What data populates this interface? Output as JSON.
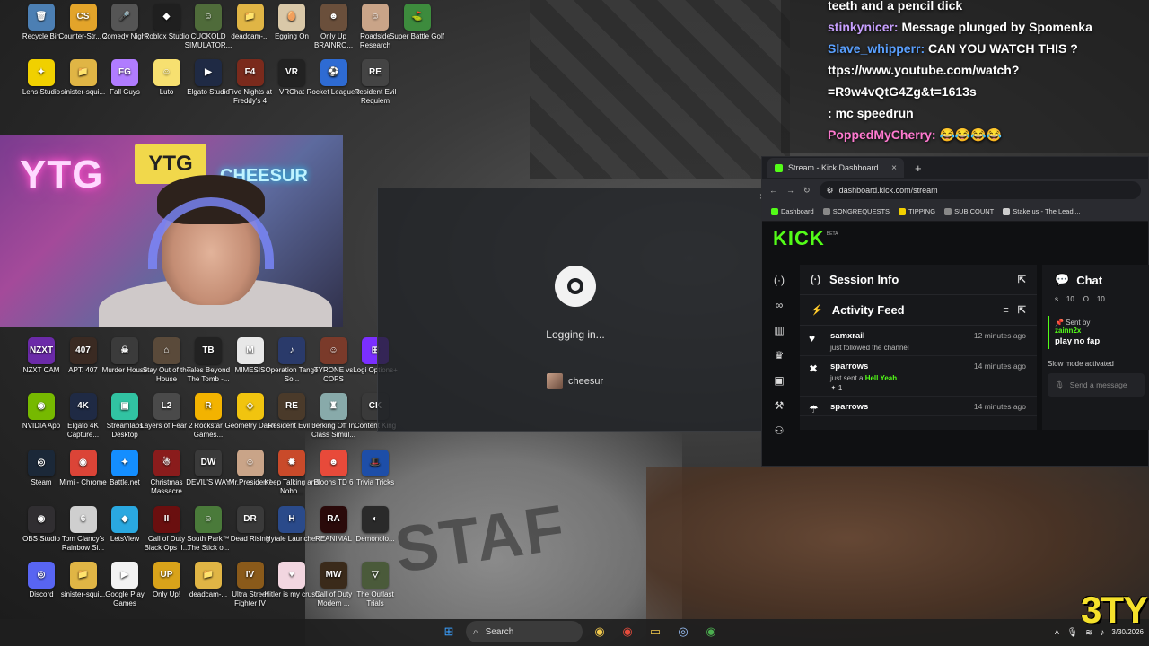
{
  "desktop_icons": [
    {
      "label": "Recycle Bin",
      "color": "#4c7fb3",
      "glyph": "🗑"
    },
    {
      "label": "Counter-Str... 2",
      "color": "#e3a42a",
      "glyph": "CS"
    },
    {
      "label": "Comedy Night",
      "color": "#555555",
      "glyph": "🎤"
    },
    {
      "label": "Roblox Studio",
      "color": "#1f1f1f",
      "glyph": "◆"
    },
    {
      "label": "CUCKOLD SIMULATOR...",
      "color": "#4f6b3a",
      "glyph": "☺"
    },
    {
      "label": "deadcam-...",
      "color": "#e0b545",
      "glyph": "📁"
    },
    {
      "label": "Egging On",
      "color": "#d9c8a8",
      "glyph": "🥚"
    },
    {
      "label": "Only Up BRAINRO...",
      "color": "#6a4f3b",
      "glyph": "☻"
    },
    {
      "label": "Roadside Research",
      "color": "#c9a488",
      "glyph": "☺"
    },
    {
      "label": "Super Battle Golf",
      "color": "#3d8b3d",
      "glyph": "⛳"
    },
    {
      "label": "Lens Studio",
      "color": "#f0d000",
      "glyph": "✦"
    },
    {
      "label": "sinister-squi...",
      "color": "#e0b545",
      "glyph": "📁"
    },
    {
      "label": "Fall Guys",
      "color": "#b07cff",
      "glyph": "FG"
    },
    {
      "label": "Luto",
      "color": "#f7e070",
      "glyph": "☺"
    },
    {
      "label": "Elgato Studio",
      "color": "#1f2a44",
      "glyph": "▶"
    },
    {
      "label": "Five Nights at Freddy's 4",
      "color": "#7a2a1c",
      "glyph": "F4"
    },
    {
      "label": "VRChat",
      "color": "#222222",
      "glyph": "VR"
    },
    {
      "label": "Rocket League®",
      "color": "#2e6bd3",
      "glyph": "⚽"
    },
    {
      "label": "Resident Evil Requiem",
      "color": "#444444",
      "glyph": "RE"
    },
    {
      "label": "NZXT CAM",
      "color": "#6b2aa8",
      "glyph": "NZXT"
    },
    {
      "label": "APT. 407",
      "color": "#3a2a22",
      "glyph": "407"
    },
    {
      "label": "Murder House",
      "color": "#3b3b3b",
      "glyph": "☠"
    },
    {
      "label": "Stay Out of the House",
      "color": "#5a4a3a",
      "glyph": "⌂"
    },
    {
      "label": "Tales Beyond The Tomb -...",
      "color": "#222222",
      "glyph": "TB"
    },
    {
      "label": "MIMESIS",
      "color": "#e8e8e8",
      "glyph": "M"
    },
    {
      "label": "Operation Tango So...",
      "color": "#2a3a6a",
      "glyph": "♪"
    },
    {
      "label": "TYRONE vs COPS",
      "color": "#7a3a2a",
      "glyph": "☺"
    },
    {
      "label": "Logi Options+",
      "color": "#7b2fff",
      "glyph": "⊞"
    },
    {
      "label": "NVIDIA App",
      "color": "#76b900",
      "glyph": "◉"
    },
    {
      "label": "Elgato 4K Capture...",
      "color": "#1f2a44",
      "glyph": "4K"
    },
    {
      "label": "Streamlabs Desktop",
      "color": "#31c3a2",
      "glyph": "▣"
    },
    {
      "label": "Layers of Fear 2",
      "color": "#4a4a4a",
      "glyph": "L2"
    },
    {
      "label": "Rockstar Games...",
      "color": "#f3b300",
      "glyph": "R"
    },
    {
      "label": "Geometry Dash",
      "color": "#f1c40f",
      "glyph": "◇"
    },
    {
      "label": "Resident Evil 5",
      "color": "#4a3a2a",
      "glyph": "RE"
    },
    {
      "label": "Jerking Off In Class Simul...",
      "color": "#8aa",
      "glyph": "♜"
    },
    {
      "label": "Content King",
      "color": "#3a3a3a",
      "glyph": "CK"
    },
    {
      "label": "Steam",
      "color": "#1b2838",
      "glyph": "◎"
    },
    {
      "label": "Mimi - Chrome",
      "color": "#db4437",
      "glyph": "◉"
    },
    {
      "label": "Battle.net",
      "color": "#148eff",
      "glyph": "✦"
    },
    {
      "label": "Christmas Massacre",
      "color": "#8a1c1c",
      "glyph": "☃"
    },
    {
      "label": "DEVIL'S WAY",
      "color": "#3a3a3a",
      "glyph": "DW"
    },
    {
      "label": "Mr.President!",
      "color": "#c9a488",
      "glyph": "☺"
    },
    {
      "label": "Keep Talking and Nobo...",
      "color": "#c94a2a",
      "glyph": "✹"
    },
    {
      "label": "Bloons TD 6",
      "color": "#e84a3a",
      "glyph": "☻"
    },
    {
      "label": "Trivia Tricks",
      "color": "#1d4ea8",
      "glyph": "🎩"
    },
    {
      "label": "OBS Studio",
      "color": "#302e31",
      "glyph": "◉"
    },
    {
      "label": "Tom Clancy's Rainbow Si...",
      "color": "#cfcfcf",
      "glyph": "6"
    },
    {
      "label": "LetsView",
      "color": "#2aa8e0",
      "glyph": "◆"
    },
    {
      "label": "Call of Duty Black Ops II...",
      "color": "#6a0f0f",
      "glyph": "II"
    },
    {
      "label": "South Park™ The Stick o...",
      "color": "#4a7a3a",
      "glyph": "☺"
    },
    {
      "label": "Dead Rising",
      "color": "#3a3a3a",
      "glyph": "DR"
    },
    {
      "label": "Hytale Launcher",
      "color": "#2a4a8a",
      "glyph": "H"
    },
    {
      "label": "REANIMAL",
      "color": "#2a0a0a",
      "glyph": "RA"
    },
    {
      "label": "Demonolo...",
      "color": "#2a2a2a",
      "glyph": "◐"
    },
    {
      "label": "Discord",
      "color": "#5865f2",
      "glyph": "◎"
    },
    {
      "label": "sinister-squi...",
      "color": "#e0b545",
      "glyph": "📁"
    },
    {
      "label": "Google Play Games",
      "color": "#f2f2f2",
      "glyph": "▶"
    },
    {
      "label": "Only Up!",
      "color": "#d9a31a",
      "glyph": "UP"
    },
    {
      "label": "deadcam-...",
      "color": "#e0b545",
      "glyph": "📁"
    },
    {
      "label": "Ultra Street Fighter IV",
      "color": "#8a5a1a",
      "glyph": "IV"
    },
    {
      "label": "Hitler is my crush",
      "color": "#f2d6e0",
      "glyph": "♥"
    },
    {
      "label": "Call of Duty Modern ...",
      "color": "#3a2a1a",
      "glyph": "MW"
    },
    {
      "label": "The Outlast Trials",
      "color": "#4a5a3a",
      "glyph": "▽"
    }
  ],
  "webcam": {
    "sign1": "YTG",
    "sign2": "YTG",
    "sign3": "CHEESUR"
  },
  "chat_overlay": [
    {
      "name": "",
      "text": "teeth and a pencil dick",
      "name_color": "#ffffff"
    },
    {
      "name": "stinkynicer:",
      "text": "Message plunged by Spomenka",
      "name_color": "#c8a0ff"
    },
    {
      "name": "Slave_whipperr:",
      "text": "CAN YOU WATCH THIS ?",
      "name_color": "#5aa0ff"
    },
    {
      "name": "",
      "text": "ttps://www.youtube.com/watch?",
      "name_color": "#ffffff"
    },
    {
      "name": "",
      "text": "=R9w4vQtG4Zg&t=1613s",
      "name_color": "#ffffff"
    },
    {
      "name": ":",
      "text": "mc speedrun",
      "name_color": "#ffffff"
    },
    {
      "name": "PoppedMyCherry:",
      "text": "😂😂😂😂",
      "name_color": "#ff7ad0"
    }
  ],
  "steam_dialog": {
    "status": "Logging in...",
    "username": "cheesur",
    "close": "×"
  },
  "browser": {
    "tab_title": "Stream - Kick Dashboard",
    "tab_close": "×",
    "new_tab": "+",
    "url": "dashboard.kick.com/stream",
    "bookmarks": [
      {
        "label": "Dashboard",
        "color": "#53fc18"
      },
      {
        "label": "SONGREQUESTS",
        "color": "#888888"
      },
      {
        "label": "TIPPING",
        "color": "#f3d000"
      },
      {
        "label": "SUB COUNT",
        "color": "#888888"
      },
      {
        "label": "Stake.us - The Leadi...",
        "color": "#cccccc"
      }
    ]
  },
  "kick": {
    "logo": "KICK",
    "beta": "BETA",
    "session_info": "Session Info",
    "activity_feed": "Activity Feed",
    "chat_title": "Chat",
    "chat_stats": [
      "s... 10",
      "O... 10"
    ],
    "feed": [
      {
        "user": "samxrail",
        "time": "12 minutes ago",
        "action": "just followed the channel",
        "gift": "",
        "count": ""
      },
      {
        "user": "sparrows",
        "time": "14 minutes ago",
        "action": "just sent a",
        "gift": "Hell Yeah",
        "count": "1"
      },
      {
        "user": "sparrows",
        "time": "14 minutes ago",
        "action": "",
        "gift": "",
        "count": ""
      }
    ],
    "sent_by_label": "Sent by",
    "sent_by_user": "zainn2x",
    "sent_msg": "play no fap",
    "slow_mode": "Slow mode activated",
    "chat_placeholder": "Send a message"
  },
  "taskbar": {
    "search": "Search",
    "date": "3/30/2026",
    "accent": "#53fc18"
  },
  "ytg_logo": "3TY"
}
